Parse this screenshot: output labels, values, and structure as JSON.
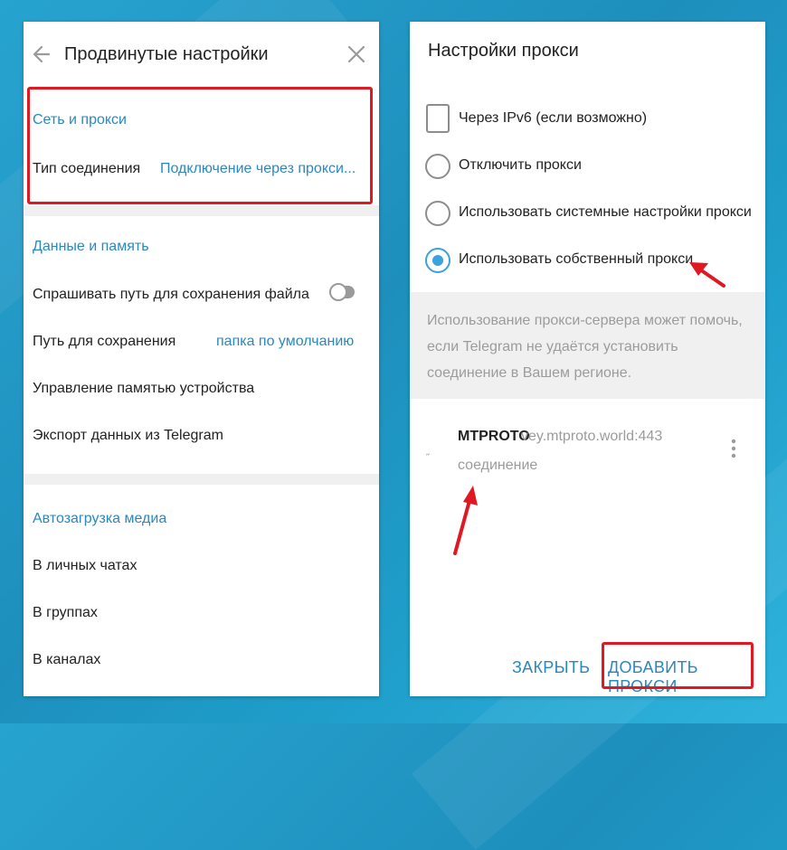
{
  "left_panel": {
    "title": "Продвинутые настройки",
    "network": {
      "heading": "Сеть и прокси",
      "connection_type_label": "Тип соединения",
      "connection_type_value": "Подключение через прокси..."
    },
    "data_memory": {
      "heading": "Данные и память",
      "ask_path_label": "Спрашивать путь для сохранения файла",
      "ask_path_enabled": false,
      "save_path_label": "Путь для сохранения",
      "save_path_value": "папка по умолчанию",
      "manage_storage_label": "Управление памятью устройства",
      "export_label": "Экспорт данных из Telegram"
    },
    "autoload": {
      "heading": "Автозагрузка медиа",
      "private_chats": "В личных чатах",
      "groups": "В группах",
      "channels": "В каналах"
    }
  },
  "right_panel": {
    "title": "Настройки прокси",
    "options": {
      "ipv6_label": "Через IPv6 (если возможно)",
      "ipv6_checked": false,
      "disable_label": "Отключить прокси",
      "system_label": "Использовать системные настройки прокси",
      "custom_label": "Использовать собственный прокси",
      "selected": "custom"
    },
    "info_text": "Использование прокси-сервера может помочь, если Telegram не удаётся установить соединение в Вашем регионе.",
    "proxy_item": {
      "type": "MTPROTO",
      "address": "vey.mtproto.world:443",
      "status": "соединение"
    },
    "close_button": "ЗАКРЫТЬ",
    "add_button": "ДОБАВИТЬ ПРОКСИ"
  },
  "colors": {
    "accent": "#2a88bf",
    "highlight": "#e01822",
    "radio_selected": "#3aa3df",
    "background": "#1e8fbd"
  },
  "icons": {
    "back": "back-arrow-icon",
    "close": "close-icon",
    "menu": "more-vertical-icon"
  }
}
